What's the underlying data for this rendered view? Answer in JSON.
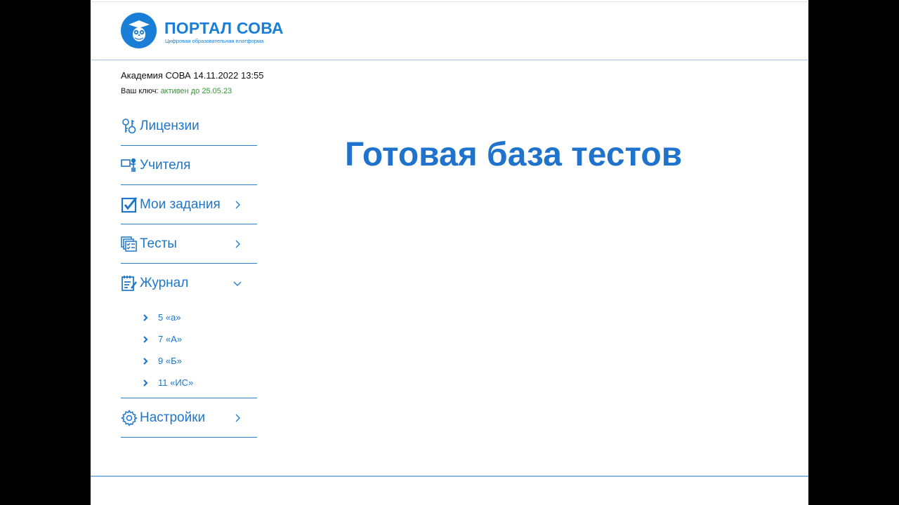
{
  "brand": {
    "title": "ПОРТАЛ СОВА",
    "subtitle": "Цифровая образовательная платформа",
    "logo_icon": "owl-icon",
    "accent_color": "#1a7ed6"
  },
  "account": {
    "org_line": "Академия СОВА 14.11.2022 13:55",
    "key_label": "Ваш ключ:",
    "key_status": "активен до 25.05.23",
    "key_status_color": "#2e9a2e"
  },
  "menu": {
    "items": [
      {
        "label": "Лицензии",
        "icon": "keys-icon",
        "has_chevron": false
      },
      {
        "label": "Учителя",
        "icon": "teacher-board-icon",
        "has_chevron": false
      },
      {
        "label": "Мои задания",
        "icon": "checkbox-icon",
        "has_chevron": true,
        "chevron": "right"
      },
      {
        "label": "Тесты",
        "icon": "tests-icon",
        "has_chevron": true,
        "chevron": "right"
      },
      {
        "label": "Журнал",
        "icon": "journal-icon",
        "has_chevron": true,
        "chevron": "down",
        "expanded": true
      },
      {
        "label": "Настройки",
        "icon": "gear-icon",
        "has_chevron": true,
        "chevron": "right"
      }
    ],
    "journal_classes": [
      "5 «а»",
      "7 «А»",
      "9 «Б»",
      "11 «ИС»"
    ]
  },
  "main": {
    "title": "Готовая база тестов"
  }
}
